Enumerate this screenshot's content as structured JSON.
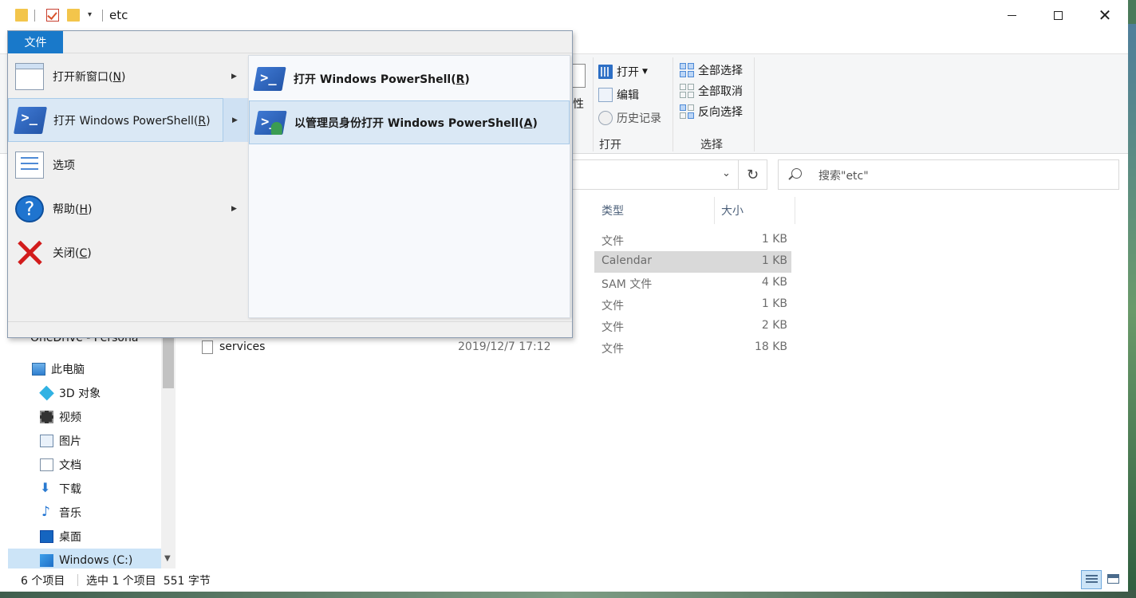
{
  "window": {
    "title": "etc"
  },
  "title_controls": {
    "minimize": "minimize",
    "maximize": "maximize",
    "close": "close"
  },
  "ribbon": {
    "property_fragment": "性",
    "open_group": {
      "open_label": "打开",
      "edit_label": "编辑",
      "history_label": "历史记录",
      "group_label": "打开"
    },
    "select_group": {
      "select_all": "全部选择",
      "select_none": "全部取消",
      "invert": "反向选择",
      "group_label": "选择"
    }
  },
  "search": {
    "placeholder": "搜索\"etc\""
  },
  "columns": {
    "type": "类型",
    "size": "大小"
  },
  "files": [
    {
      "name": "",
      "date": "",
      "type": "文件",
      "size": "1 KB"
    },
    {
      "name": "",
      "date": "",
      "type": "Calendar",
      "size": "1 KB",
      "selected": true
    },
    {
      "name": "",
      "date": "",
      "type": "SAM 文件",
      "size": "4 KB"
    },
    {
      "name": "",
      "date": "",
      "type": "文件",
      "size": "1 KB"
    },
    {
      "name": "",
      "date": "",
      "type": "文件",
      "size": "2 KB"
    },
    {
      "name": "services",
      "date": "2019/12/7 17:12",
      "type": "文件",
      "size": "18 KB"
    }
  ],
  "nav": {
    "onedrive_partial": "OneDrive - Persona",
    "this_pc": "此电脑",
    "items": [
      {
        "label": "3D 对象",
        "icon": "cube-icon"
      },
      {
        "label": "视频",
        "icon": "video-icon"
      },
      {
        "label": "图片",
        "icon": "picture-icon"
      },
      {
        "label": "文档",
        "icon": "document-icon"
      },
      {
        "label": "下载",
        "icon": "download-icon"
      },
      {
        "label": "音乐",
        "icon": "music-icon"
      },
      {
        "label": "桌面",
        "icon": "desktop-icon"
      },
      {
        "label": "Windows (C:)",
        "icon": "drive-icon"
      }
    ]
  },
  "status": {
    "item_count": "6 个项目",
    "selected": "选中 1 个项目  551 字节"
  },
  "file_menu": {
    "tab_label": "文件",
    "items": [
      {
        "label_pre": "打开新窗口(",
        "key": "N",
        "label_post": ")",
        "has_arrow": true
      },
      {
        "label_pre": "打开 Windows PowerShell(",
        "key": "R",
        "label_post": ")",
        "has_arrow": true,
        "active": true
      },
      {
        "label_pre": "选项",
        "key": "",
        "label_post": "",
        "has_arrow": false
      },
      {
        "label_pre": "帮助(",
        "key": "H",
        "label_post": ")",
        "has_arrow": true
      },
      {
        "label_pre": "关闭(",
        "key": "C",
        "label_post": ")",
        "has_arrow": false
      }
    ],
    "submenu": [
      {
        "label_pre": "打开 Windows PowerShell(",
        "key": "R",
        "label_post": ")"
      },
      {
        "label_pre": "以管理员身份打开 Windows PowerShell(",
        "key": "A",
        "label_post": ")"
      }
    ]
  },
  "icons": {
    "help_glyph": "?",
    "arrow_glyph": "▶",
    "chevron_glyph": "⌄",
    "refresh_glyph": "↻"
  }
}
